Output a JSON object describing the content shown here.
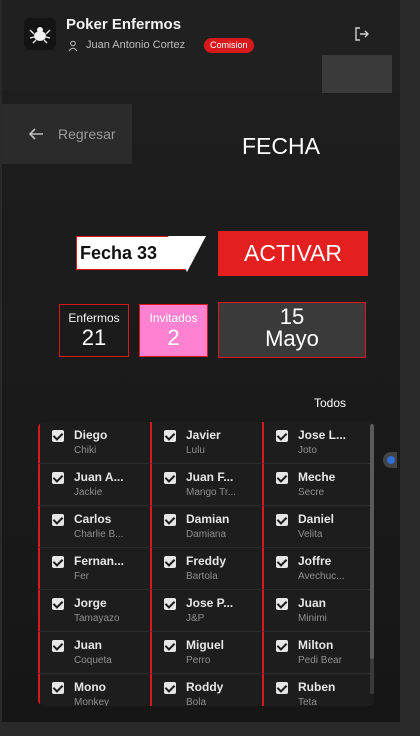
{
  "header": {
    "app_title": "Poker Enfermos",
    "user_name": "Juan Antonio Cortez",
    "role_badge": "Comision"
  },
  "nav": {
    "back_label": "Regresar"
  },
  "page": {
    "title": "FECHA"
  },
  "controls": {
    "fecha_value": "Fecha 3",
    "fecha_ghost": "3",
    "activate_label": "ACTIVAR"
  },
  "stats": {
    "enfermos_label": "Enfermos",
    "enfermos_value": "21",
    "invitados_label": "Invitados",
    "invitados_value": "2",
    "date_day": "15",
    "date_month": "Mayo"
  },
  "players": {
    "toggle_all_label": "Todos",
    "columns": [
      [
        {
          "name": "Diego",
          "nick": "Chiki"
        },
        {
          "name": "Juan A...",
          "nick": "Jackie"
        },
        {
          "name": "Carlos",
          "nick": "Charlie B..."
        },
        {
          "name": "Fernan...",
          "nick": "Fer"
        },
        {
          "name": "Jorge",
          "nick": "Tamayazo"
        },
        {
          "name": "Juan",
          "nick": "Coqueta"
        },
        {
          "name": "Mono",
          "nick": "Monkey"
        }
      ],
      [
        {
          "name": "Javier",
          "nick": "Lulu"
        },
        {
          "name": "Juan F...",
          "nick": "Mango Tr..."
        },
        {
          "name": "Damian",
          "nick": "Damiana"
        },
        {
          "name": "Freddy",
          "nick": "Bartola"
        },
        {
          "name": "Jose P...",
          "nick": "J&P"
        },
        {
          "name": "Miguel",
          "nick": "Perro"
        },
        {
          "name": "Roddy",
          "nick": "Bola"
        }
      ],
      [
        {
          "name": "Jose L...",
          "nick": "Joto"
        },
        {
          "name": "Meche",
          "nick": "Secre"
        },
        {
          "name": "Daniel",
          "nick": "Velita"
        },
        {
          "name": "Joffre",
          "nick": "Avechuc..."
        },
        {
          "name": "Juan",
          "nick": "Minimi"
        },
        {
          "name": "Milton",
          "nick": "Pedi Bear"
        },
        {
          "name": "Ruben",
          "nick": "Teta"
        }
      ]
    ]
  },
  "colors": {
    "accent_red": "#e41f1f",
    "invitados_pink": "#ff82d2",
    "background": "#1a1a1a"
  }
}
